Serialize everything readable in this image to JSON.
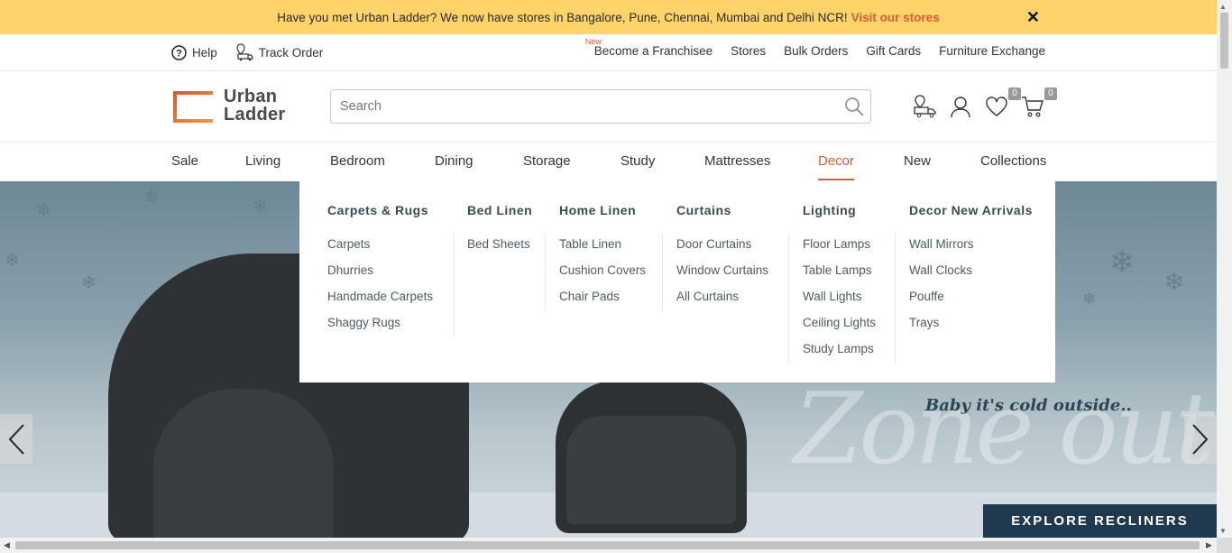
{
  "announcement": {
    "text": "Have you met Urban Ladder? We now have stores in Bangalore, Pune, Chennai, Mumbai and Delhi NCR!",
    "link": "Visit our stores",
    "close": "✕"
  },
  "utility": {
    "help": "Help",
    "track_order": "Track Order",
    "new_badge": "New",
    "links": [
      "Become a Franchisee",
      "Stores",
      "Bulk Orders",
      "Gift Cards",
      "Furniture Exchange"
    ]
  },
  "header": {
    "logo_line1": "Urban",
    "logo_line2": "Ladder",
    "search_placeholder": "Search",
    "wishlist_count": "0",
    "cart_count": "0"
  },
  "nav": {
    "items": [
      "Sale",
      "Living",
      "Bedroom",
      "Dining",
      "Storage",
      "Study",
      "Mattresses",
      "Decor",
      "New",
      "Collections"
    ],
    "active": "Decor"
  },
  "mega_menu": {
    "columns": [
      {
        "title": "Carpets & Rugs",
        "links": [
          "Carpets",
          "Dhurries",
          "Handmade Carpets",
          "Shaggy Rugs"
        ]
      },
      {
        "title": "Bed Linen",
        "links": [
          "Bed Sheets"
        ]
      },
      {
        "title": "Home Linen",
        "links": [
          "Table Linen",
          "Cushion Covers",
          "Chair Pads"
        ]
      },
      {
        "title": "Curtains",
        "links": [
          "Door Curtains",
          "Window Curtains",
          "All Curtains"
        ]
      },
      {
        "title": "Lighting",
        "links": [
          "Floor Lamps",
          "Table Lamps",
          "Wall Lights",
          "Ceiling Lights",
          "Study Lamps"
        ]
      },
      {
        "title": "Decor New Arrivals",
        "links": [
          "Wall Mirrors",
          "Wall Clocks",
          "Pouffe",
          "Trays"
        ]
      }
    ]
  },
  "hero": {
    "tagline": "Baby it's cold outside..",
    "headline": "Zone out",
    "cta": "EXPLORE RECLINERS",
    "prev": "‹",
    "next": "›"
  },
  "colors": {
    "accent": "#e05a37",
    "announcement_bg": "#fdd36a",
    "cta_bg": "#1f3a4f"
  }
}
